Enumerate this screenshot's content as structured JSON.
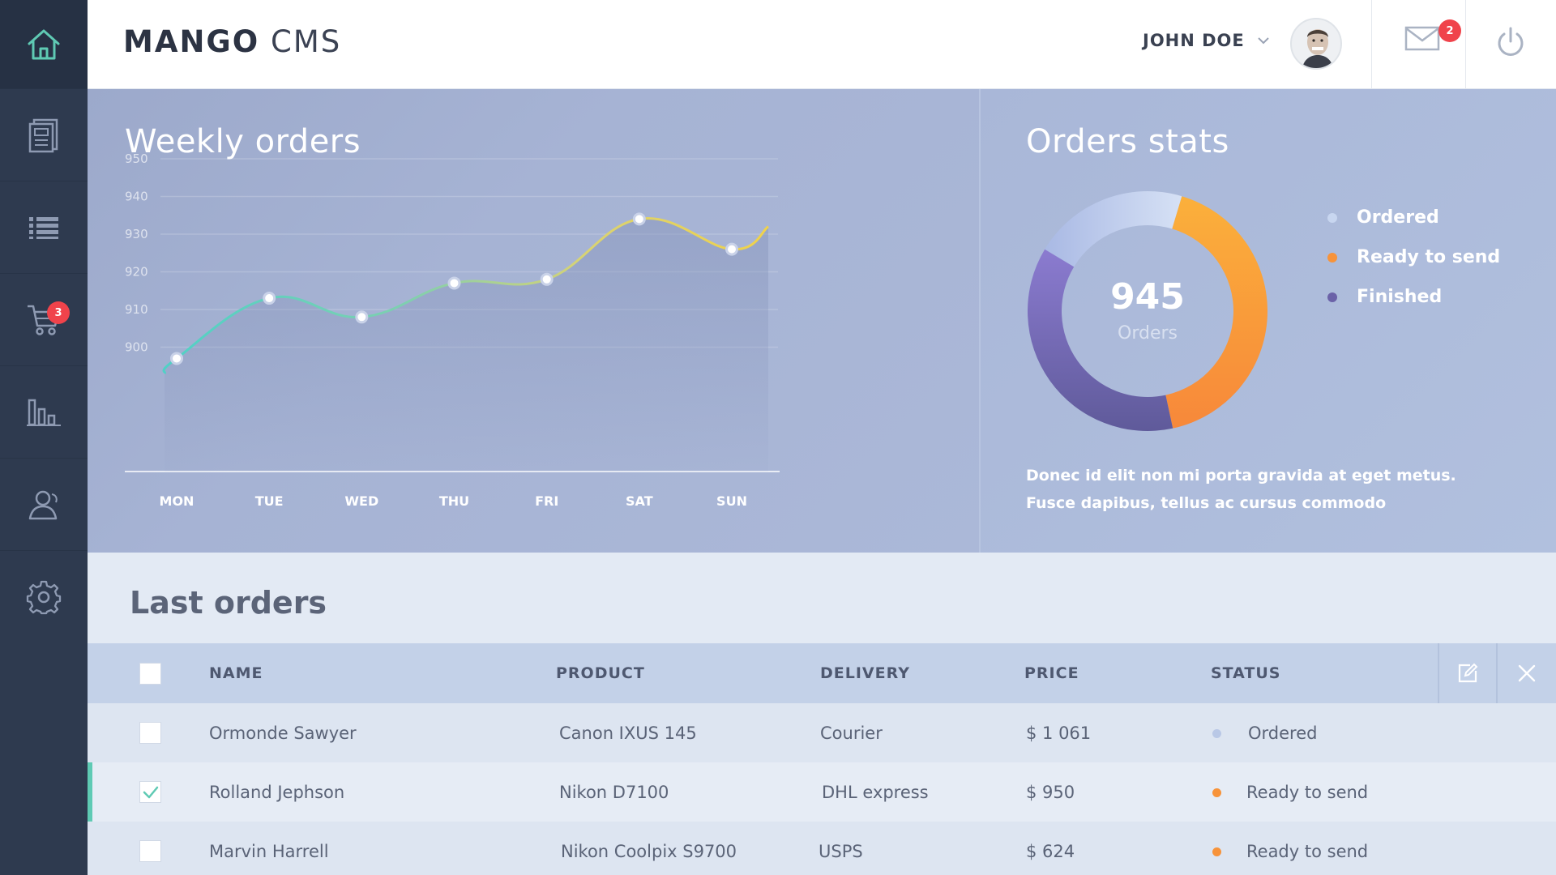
{
  "brand": {
    "bold": "MANGO",
    "light": "CMS"
  },
  "header": {
    "user_name": "JOHN DOE",
    "mail_count": "2"
  },
  "sidebar": {
    "items": [
      {
        "icon": "home-icon"
      },
      {
        "icon": "document-icon"
      },
      {
        "icon": "list-icon"
      },
      {
        "icon": "cart-icon",
        "badge": "3"
      },
      {
        "icon": "bar-chart-icon"
      },
      {
        "icon": "users-icon"
      },
      {
        "icon": "gear-icon"
      }
    ]
  },
  "weekly": {
    "title": "Weekly orders",
    "chart_data": {
      "type": "line",
      "title": "Weekly orders",
      "categories": [
        "MON",
        "TUE",
        "WED",
        "THU",
        "FRI",
        "SAT",
        "SUN"
      ],
      "values": [
        897,
        913,
        908,
        917,
        918,
        934,
        926
      ],
      "y_ticks": [
        "950",
        "940",
        "930",
        "920",
        "910",
        "900"
      ],
      "ylim": [
        890,
        950
      ],
      "grid": true
    }
  },
  "stats": {
    "title": "Orders stats",
    "total": "945",
    "total_label": "Orders",
    "legend": [
      {
        "label": "Ordered",
        "color": "#c8d6f0"
      },
      {
        "label": "Ready to send",
        "color": "#f7933a"
      },
      {
        "label": "Finished",
        "color": "#6b62a8"
      }
    ],
    "description_line1": "Donec id elit non mi porta gravida at eget metus.",
    "description_line2": "Fusce dapibus, tellus ac cursus commodo",
    "chart_data": {
      "type": "pie",
      "categories": [
        "Ordered",
        "Ready to send",
        "Finished"
      ],
      "values": [
        21,
        42,
        37
      ]
    }
  },
  "orders": {
    "title": "Last orders",
    "columns": [
      "NAME",
      "PRODUCT",
      "DELIVERY",
      "PRICE",
      "STATUS"
    ],
    "rows": [
      {
        "name": "Ormonde Sawyer",
        "product": "Canon IXUS 145",
        "delivery": "Courier",
        "price": "$ 1 061",
        "status": "Ordered",
        "status_color": "#b9c8e6",
        "checked": false
      },
      {
        "name": "Rolland Jephson",
        "product": "Nikon D7100",
        "delivery": "DHL express",
        "price": "$ 950",
        "status": "Ready to send",
        "status_color": "#f7933a",
        "checked": true
      },
      {
        "name": "Marvin Harrell",
        "product": "Nikon Coolpix S9700",
        "delivery": "USPS",
        "price": "$ 624",
        "status": "Ready to send",
        "status_color": "#f7933a",
        "checked": false
      }
    ]
  }
}
